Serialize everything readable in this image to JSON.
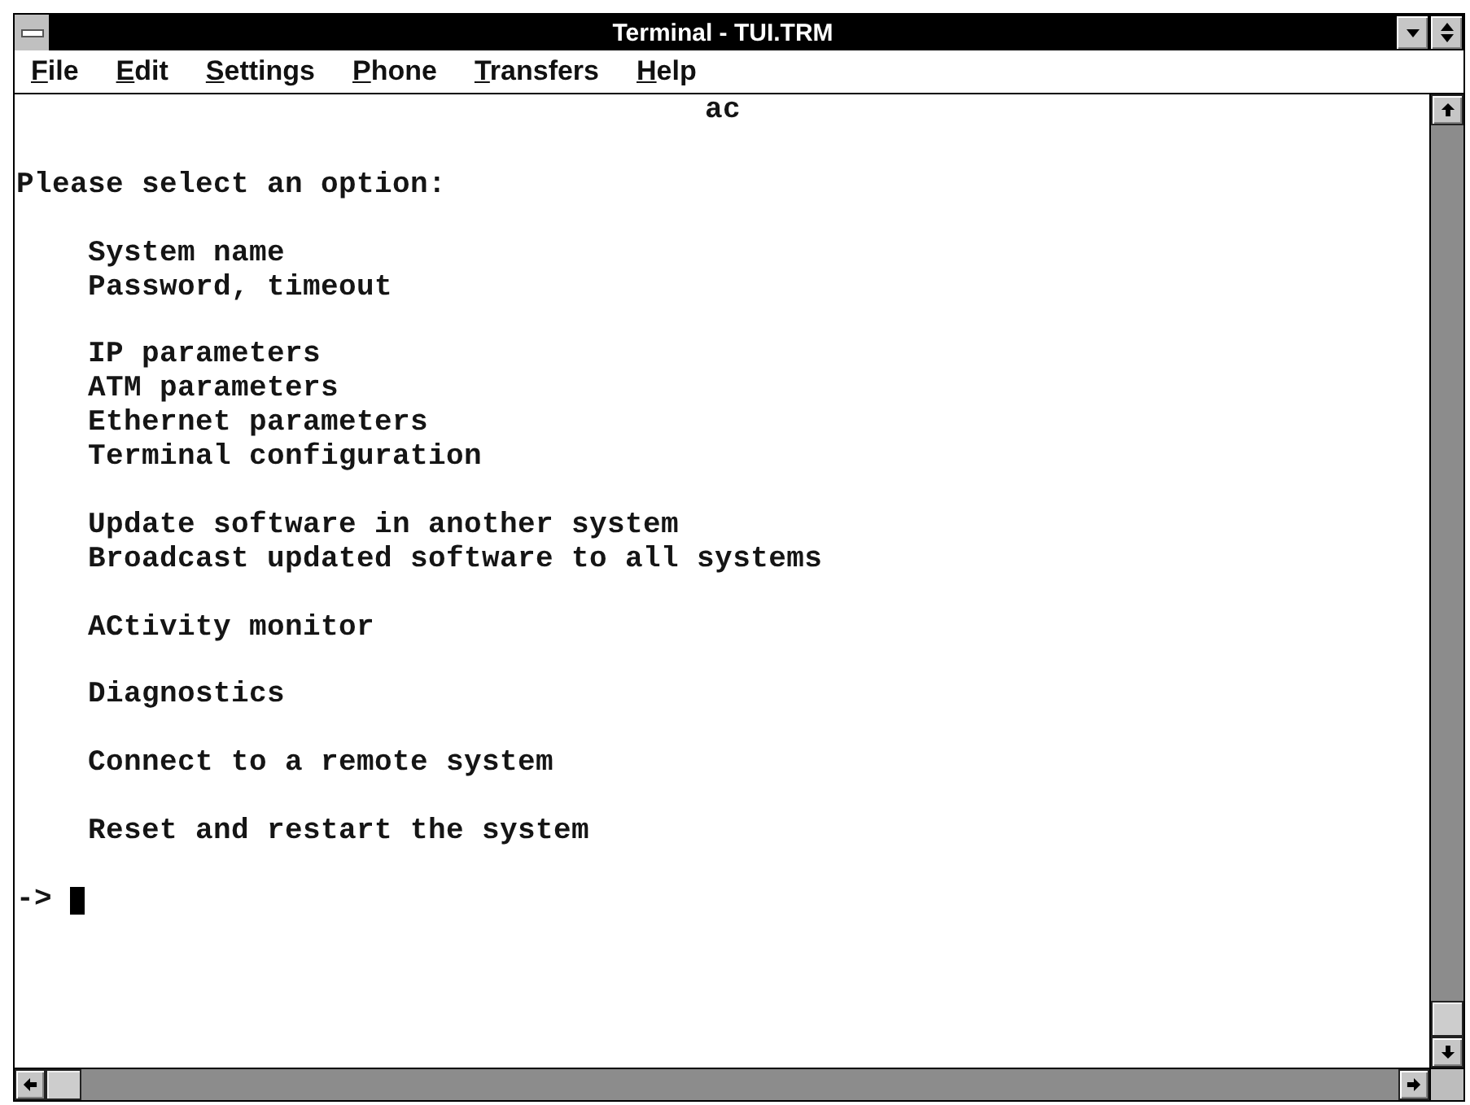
{
  "window": {
    "title": "Terminal - TUI.TRM"
  },
  "menu": [
    "File",
    "Edit",
    "Settings",
    "Phone",
    "Transfers",
    "Help"
  ],
  "terminal": {
    "header": "ac",
    "heading": "Please select an option:",
    "option_groups": [
      [
        "System name",
        "Password, timeout"
      ],
      [
        "IP parameters",
        "ATM parameters",
        "Ethernet parameters",
        "Terminal configuration"
      ],
      [
        "Update software in another system",
        "Broadcast updated software to all systems"
      ],
      [
        "ACtivity monitor"
      ],
      [
        "Diagnostics"
      ],
      [
        "Connect to a remote system"
      ],
      [
        "Reset and restart the system"
      ]
    ],
    "input_line": {
      "prompt": "->",
      "cursor": true
    }
  }
}
